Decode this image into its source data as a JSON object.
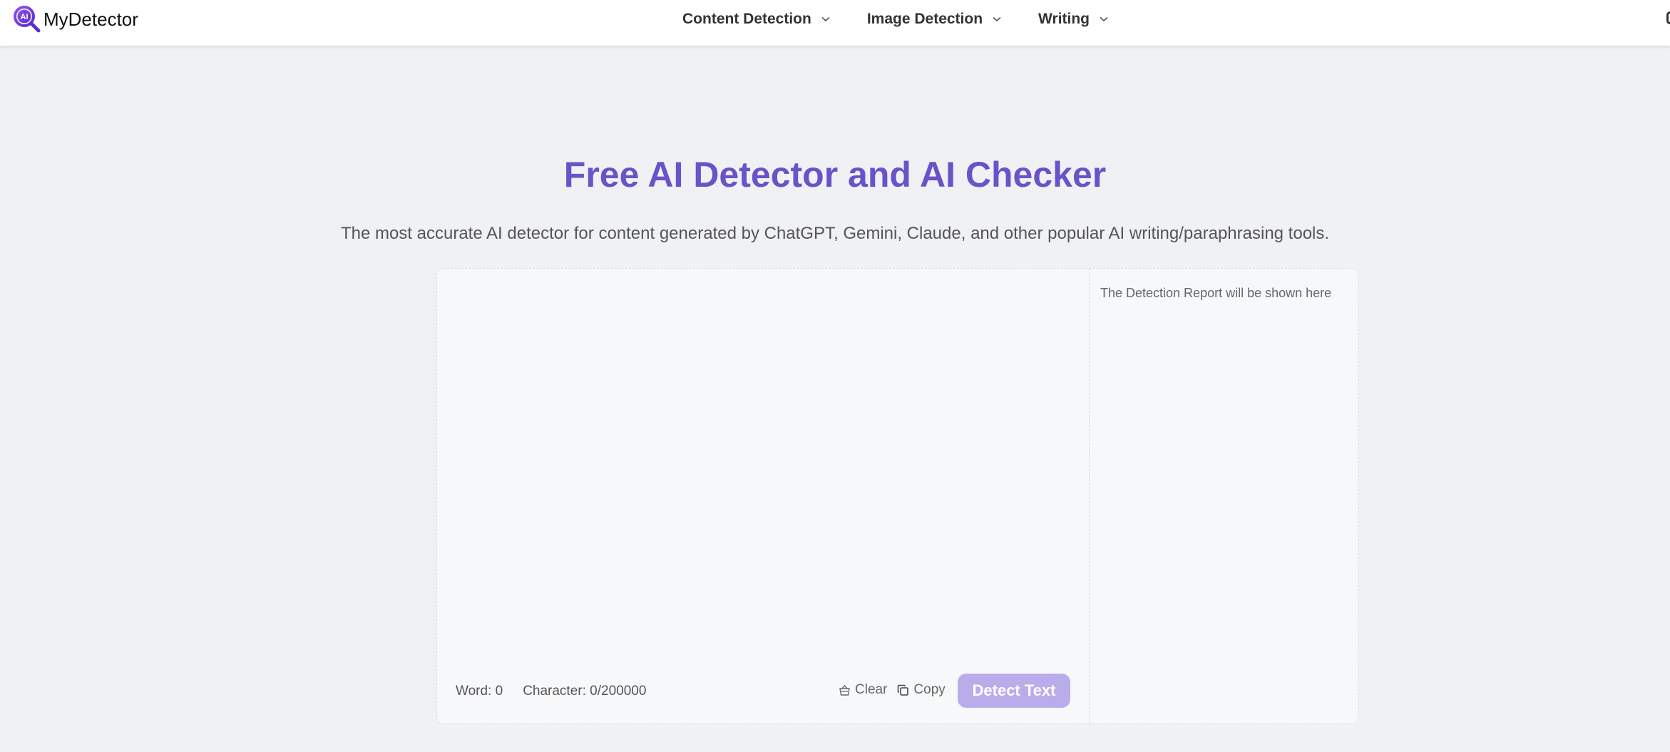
{
  "header": {
    "logo_mark": "AI",
    "logo_text": "MyDetector",
    "nav": [
      {
        "label": "Content Detection"
      },
      {
        "label": "Image Detection"
      },
      {
        "label": "Writing"
      }
    ]
  },
  "hero": {
    "title": "Free AI Detector and AI Checker",
    "subtitle": "The most accurate AI detector for content generated by ChatGPT, Gemini, Claude, and other popular AI writing/paraphrasing tools."
  },
  "editor": {
    "value": "",
    "word_count": "Word: 0",
    "char_count": "Character: 0/200000",
    "clear_label": "Clear",
    "copy_label": "Copy",
    "detect_label": "Detect Text"
  },
  "report": {
    "placeholder": "The Detection Report will be shown here"
  },
  "colors": {
    "accent": "#6a53c8",
    "button_disabled": "#b9aceb",
    "background": "#f0f1f5",
    "panel": "#f7f8fa"
  },
  "icons": [
    "ai-magnifier-logo-icon",
    "chevron-down-icon",
    "basket-clear-icon",
    "copy-icon"
  ]
}
